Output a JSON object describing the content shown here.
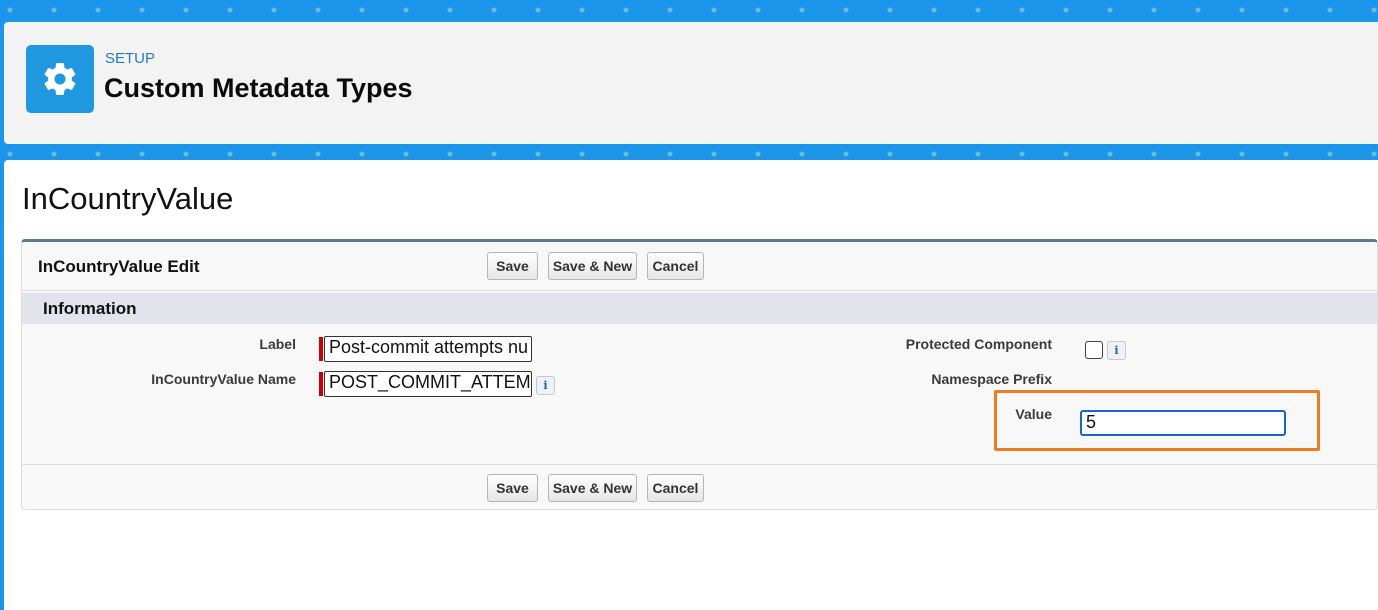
{
  "header": {
    "breadcrumb": "SETUP",
    "title": "Custom Metadata Types",
    "icon": "gear-icon"
  },
  "page": {
    "title": "InCountryValue"
  },
  "panel": {
    "title": "InCountryValue Edit",
    "buttons": {
      "save": "Save",
      "save_new": "Save & New",
      "cancel": "Cancel"
    },
    "section": {
      "title": "Information"
    },
    "fields": {
      "label": {
        "label": "Label",
        "value": "Post-commit attempts nu",
        "required": true
      },
      "name": {
        "label": "InCountryValue Name",
        "value": "POST_COMMIT_ATTEM",
        "required": true
      },
      "protected_component": {
        "label": "Protected Component",
        "checked": false
      },
      "namespace_prefix": {
        "label": "Namespace Prefix"
      },
      "value": {
        "label": "Value",
        "value": "5"
      }
    },
    "info_icon_glyph": "i"
  },
  "colors": {
    "brand_blue": "#1b96e8",
    "required_red": "#cc0000",
    "highlight_orange": "#ee7b22",
    "focus_blue": "#1668c8"
  }
}
